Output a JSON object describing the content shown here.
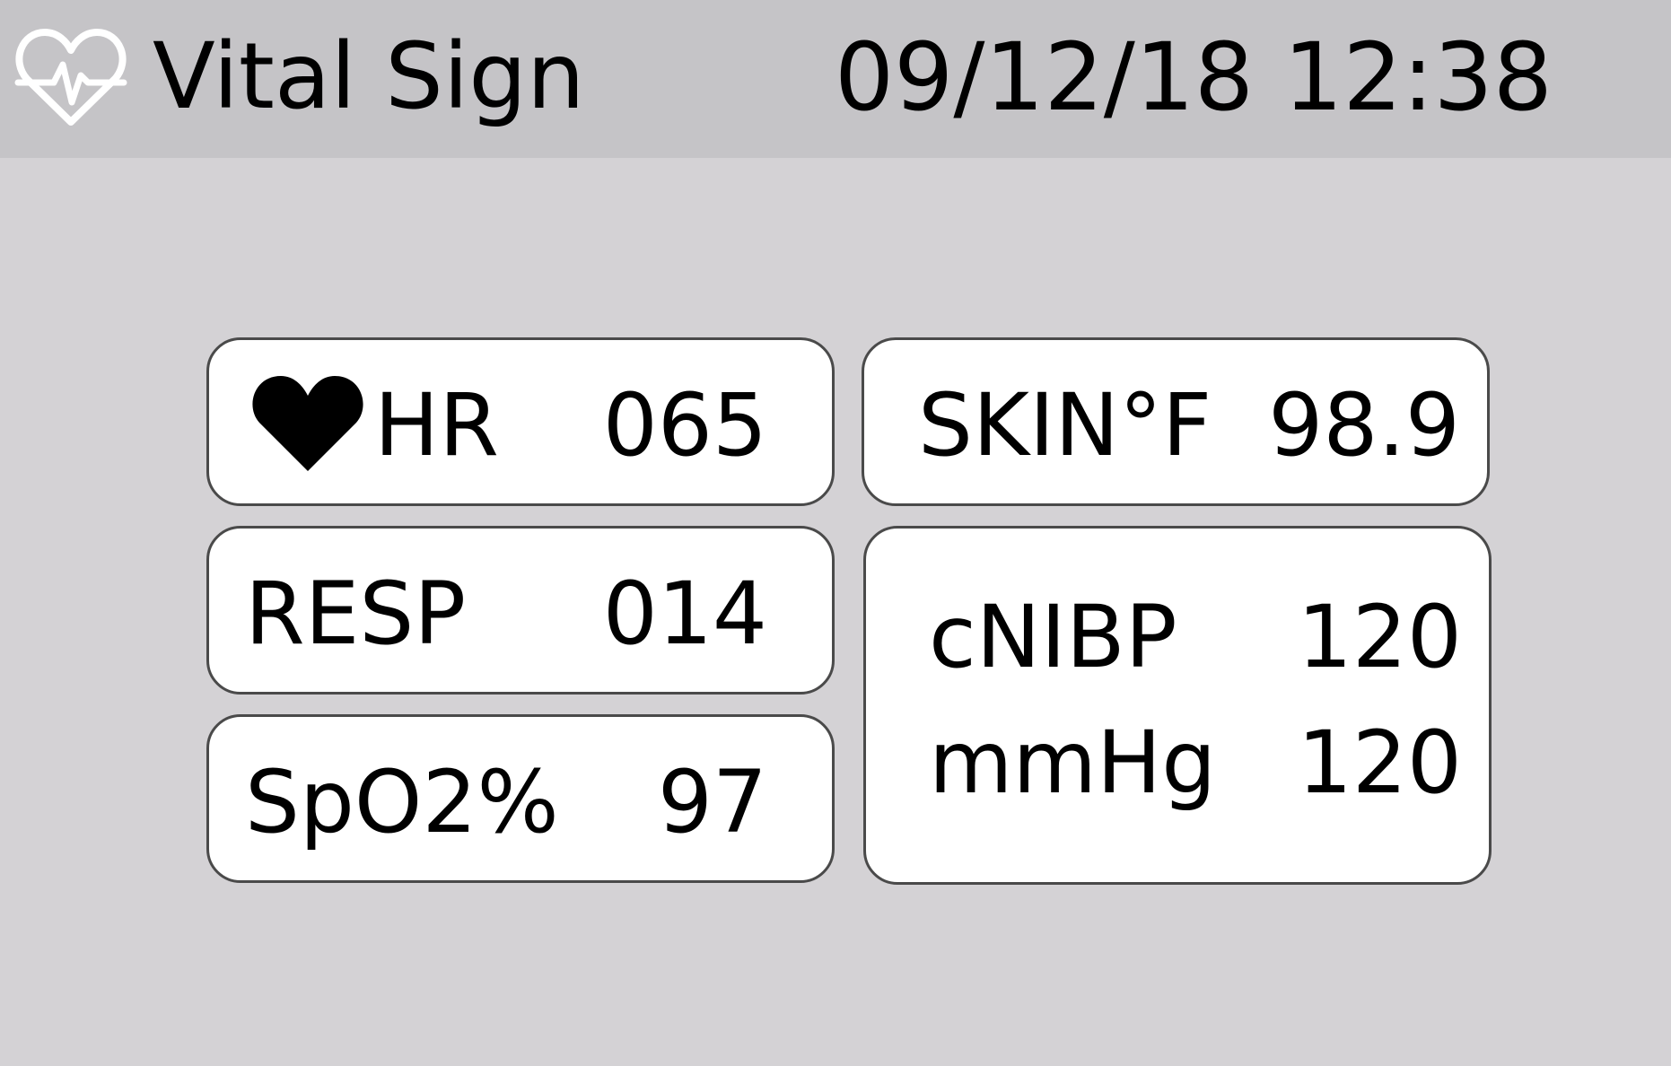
{
  "header": {
    "title": "Vital Sign",
    "datetime": "09/12/18 12:38",
    "icon": "heart-pulse-icon"
  },
  "vitals": {
    "hr": {
      "label": "HR",
      "value": "065",
      "icon": "heart-icon"
    },
    "resp": {
      "label": "RESP",
      "value": "014"
    },
    "spo2": {
      "label": "SpO2%",
      "value": "97"
    },
    "skin": {
      "label": "SKIN°F",
      "value": "98.9"
    },
    "nibp": {
      "label1": "cNIBP",
      "label2": "mmHg",
      "value1": "120",
      "value2": "120"
    }
  },
  "colors": {
    "background": "#d4d2d5",
    "header": "#c5c4c7",
    "card": "#ffffff",
    "card_border": "#4a4a4a",
    "header_icon": "#ffffff"
  }
}
